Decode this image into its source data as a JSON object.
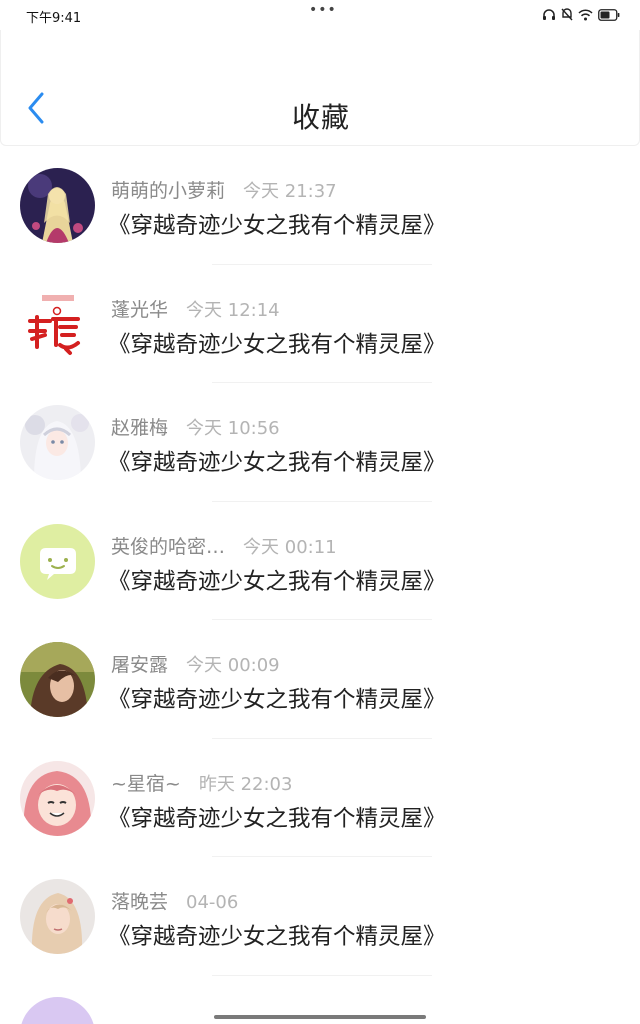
{
  "status_bar": {
    "time": "下午9:41",
    "dots": "•••"
  },
  "header": {
    "title": "收藏",
    "accent_color": "#2b8cf0"
  },
  "list": {
    "items": [
      {
        "username": "萌萌的小萝莉",
        "time": "今天 21:37",
        "title": "《穿越奇迹少女之我有个精灵屋》",
        "avatar": "anime-girl-avatar"
      },
      {
        "username": "蓬光华",
        "time": "今天 12:14",
        "title": "《穿越奇迹少女之我有个精灵屋》",
        "avatar": "calligraphy-avatar"
      },
      {
        "username": "赵雅梅",
        "time": "今天 10:56",
        "title": "《穿越奇迹少女之我有个精灵屋》",
        "avatar": "white-haired-girl-avatar"
      },
      {
        "username": "英俊的哈密…",
        "time": "今天 00:11",
        "title": "《穿越奇迹少女之我有个精灵屋》",
        "avatar": "default-smile-avatar"
      },
      {
        "username": "屠安露",
        "time": "今天 00:09",
        "title": "《穿越奇迹少女之我有个精灵屋》",
        "avatar": "portrait-photo-avatar"
      },
      {
        "username": "~星宿~",
        "time": "昨天 22:03",
        "title": "《穿越奇迹少女之我有个精灵屋》",
        "avatar": "pink-hair-girl-avatar"
      },
      {
        "username": "落晚芸",
        "time": "04-06",
        "title": "《穿越奇迹少女之我有个精灵屋》",
        "avatar": "blonde-girl-avatar"
      }
    ]
  }
}
